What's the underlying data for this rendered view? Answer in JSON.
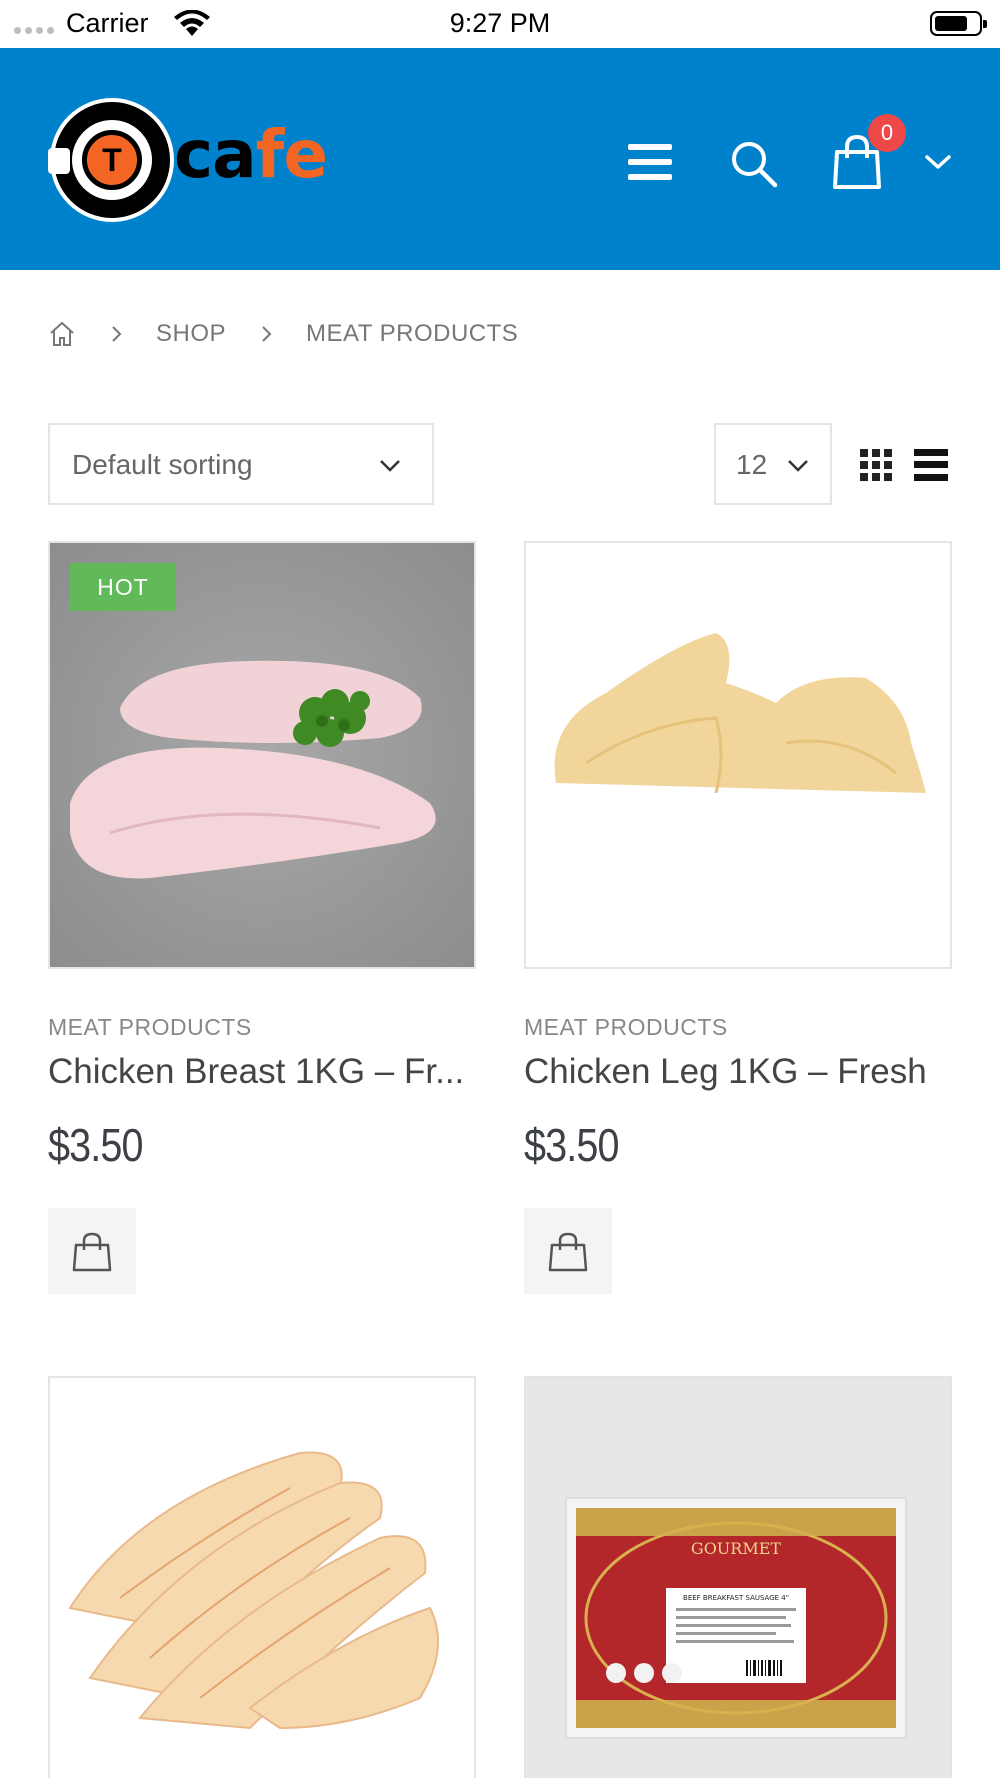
{
  "status_bar": {
    "carrier": "Carrier",
    "time": "9:27 PM"
  },
  "header": {
    "logo_text_black": "ca",
    "logo_text_orange": "fe",
    "logo_letter": "T",
    "cart_count": "0",
    "colors": {
      "header_bg": "#0081cc",
      "badge": "#ef4848",
      "logo_accent": "#f26522"
    }
  },
  "breadcrumb": {
    "items": [
      "SHOP",
      "MEAT PRODUCTS"
    ]
  },
  "toolbar": {
    "sort_label": "Default sorting",
    "per_page": "12"
  },
  "products": [
    {
      "badge": "HOT",
      "category": "MEAT PRODUCTS",
      "name": "Chicken Breast 1KG – Fr...",
      "price": "$3.50"
    },
    {
      "category": "MEAT PRODUCTS",
      "name": "Chicken Leg 1KG – Fresh",
      "price": "$3.50"
    },
    {
      "image": "chicken-wings"
    },
    {
      "image": "beef-sausage-pack",
      "pack_brand": "GOURMET",
      "pack_label": "BEEF BREAKFAST SAUSAGE 4\""
    }
  ]
}
